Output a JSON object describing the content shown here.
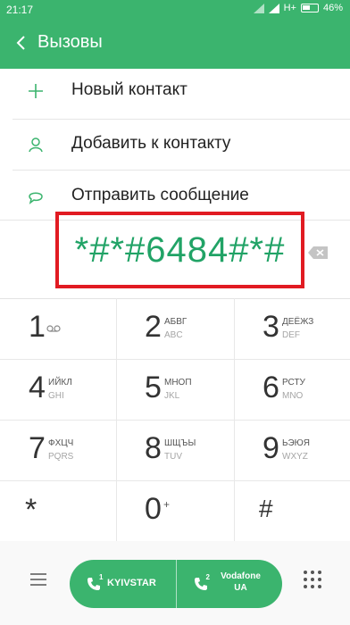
{
  "status": {
    "time": "21:17",
    "network": "H+",
    "battery": "46%"
  },
  "header": {
    "title": "Вызовы",
    "color": "#3bb46e"
  },
  "actions": [
    {
      "label": "Новый контакт",
      "icon": "plus-icon"
    },
    {
      "label": "Добавить к контакту",
      "icon": "person-icon"
    },
    {
      "label": "Отправить сообщение",
      "icon": "message-icon"
    }
  ],
  "dialed_number": "*#*#6484#*#",
  "keys": [
    {
      "digit": "1",
      "l1": "",
      "l2": ""
    },
    {
      "digit": "2",
      "l1": "АБВГ",
      "l2": "ABC"
    },
    {
      "digit": "3",
      "l1": "ДЕЁЖЗ",
      "l2": "DEF"
    },
    {
      "digit": "4",
      "l1": "ИЙКЛ",
      "l2": "GHI"
    },
    {
      "digit": "5",
      "l1": "МНОП",
      "l2": "JKL"
    },
    {
      "digit": "6",
      "l1": "РСТУ",
      "l2": "MNO"
    },
    {
      "digit": "7",
      "l1": "ФХЦЧ",
      "l2": "PQRS"
    },
    {
      "digit": "8",
      "l1": "ШЩЪЫ",
      "l2": "TUV"
    },
    {
      "digit": "9",
      "l1": "ЬЭЮЯ",
      "l2": "WXYZ"
    },
    {
      "digit": "*",
      "l1": "",
      "l2": ""
    },
    {
      "digit": "0",
      "l1": "+",
      "l2": ""
    },
    {
      "digit": "#",
      "l1": "",
      "l2": ""
    }
  ],
  "call": {
    "sim1_label": "KYIVSTAR",
    "sim2_label": "Vodafone UA",
    "sim1_num": "1",
    "sim2_num": "2"
  },
  "colors": {
    "accent": "#3bb46e",
    "number": "#21a366",
    "highlight": "#e11b22"
  }
}
